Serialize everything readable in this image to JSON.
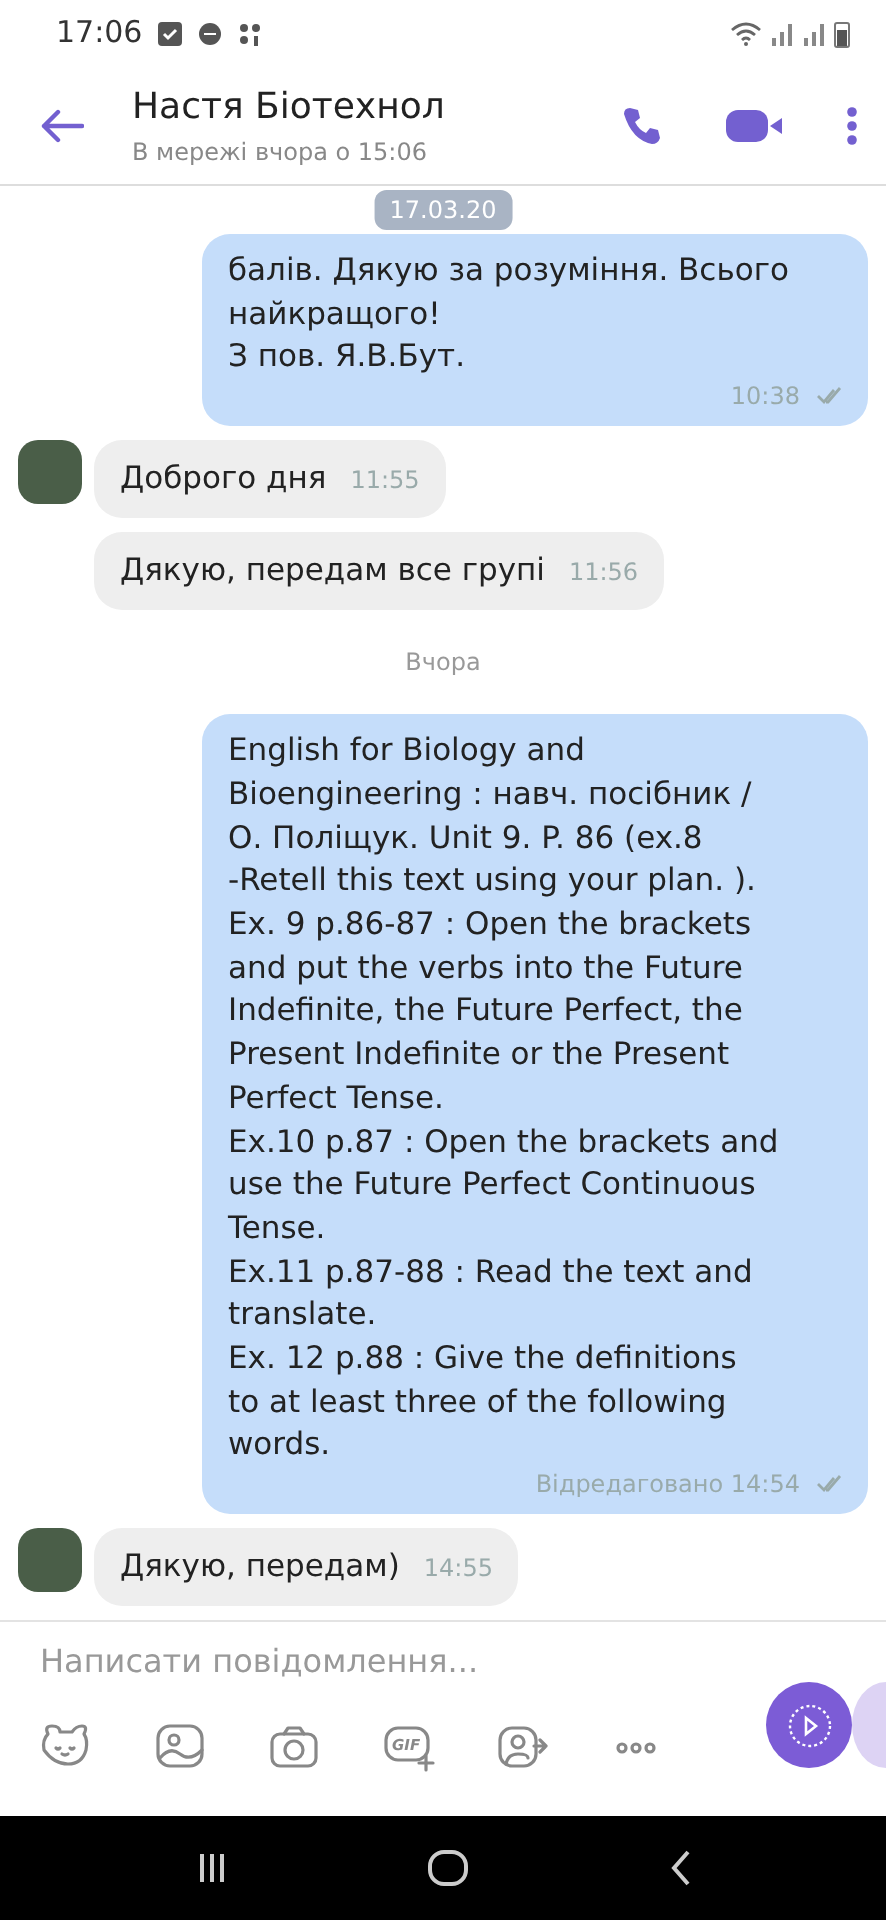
{
  "status_bar": {
    "time": "17:06"
  },
  "header": {
    "title": "Настя Біотехнол",
    "subtitle": "В мережі вчора о 15:06"
  },
  "floating_date": "17.03.20",
  "messages": [
    {
      "kind": "outgoing",
      "text": "балів. Дякую за розуміння. Всього\nнайкращого!\nЗ пов. Я.В.Бут.",
      "time": "10:38",
      "read": true
    },
    {
      "kind": "incoming",
      "text": "Доброго дня",
      "time": "11:55",
      "avatar": true
    },
    {
      "kind": "incoming",
      "text": "Дякую, передам все групі",
      "time": "11:56",
      "avatar": false
    },
    {
      "kind": "divider",
      "text": "Вчора"
    },
    {
      "kind": "outgoing",
      "text": "English for Biology and\nBioengineering : навч. посібник /\nО. Поліщук.  Unit 9. P. 86 (ex.8\n-Retell this text using your plan. ).\nEx. 9 p.86-87 : Open the brackets\nand put the verbs into the Future\nIndefinite, the Future Perfect, the\nPresent Indefinite or the Present\nPerfect Tense.\nEx.10 p.87 : Open the brackets and\nuse the Future Perfect Continuous\nTense.\nEx.11 p.87-88 : Read the text and\ntranslate.\nEx. 12 p.88 : Give the definitions\nto at least three of the following\nwords.",
      "time": "Відредаговано 14:54",
      "read": true
    },
    {
      "kind": "incoming",
      "text": "Дякую, передам)",
      "time": "14:55",
      "avatar": true
    }
  ],
  "composer": {
    "placeholder": "Написати повідомлення...",
    "gif_label": "GIF"
  }
}
